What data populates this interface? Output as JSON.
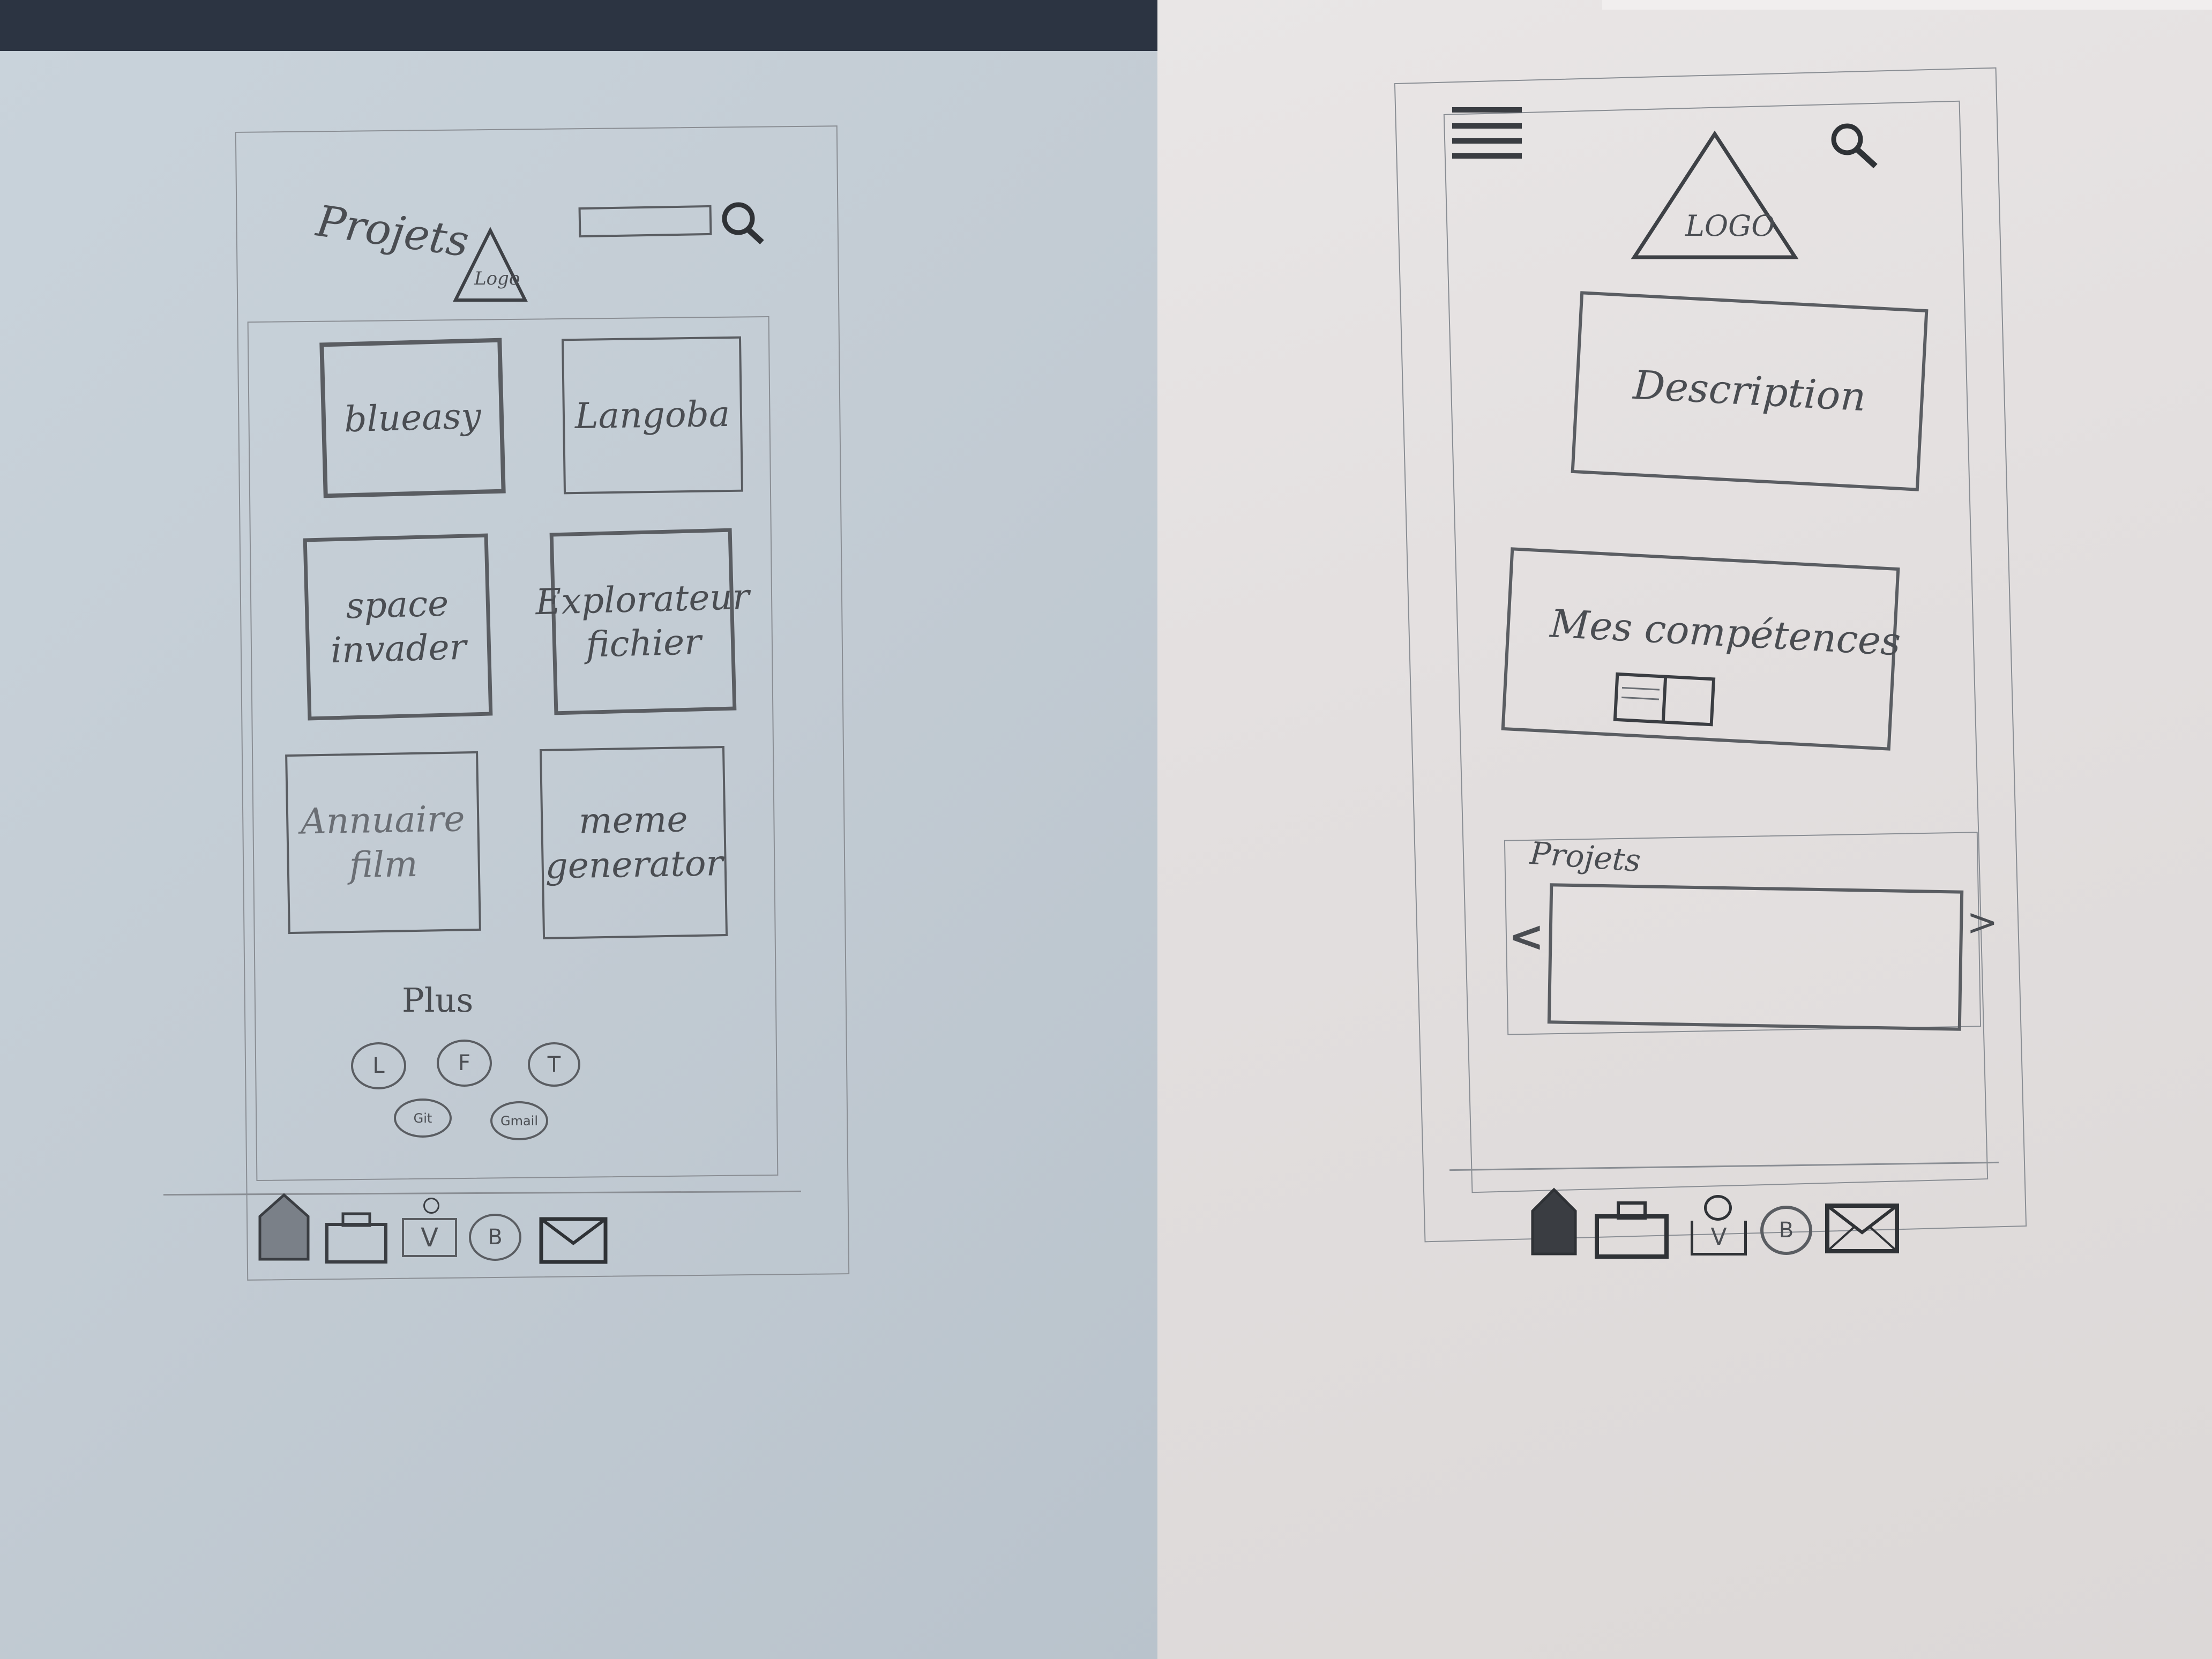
{
  "left_sketch": {
    "title": "Projets",
    "logo_text": "Logo",
    "projects": [
      {
        "label": "blueasy"
      },
      {
        "label": "Langoba"
      },
      {
        "label": "space invader"
      },
      {
        "label": "Explorateur fichier"
      },
      {
        "label": "Annuaire film"
      },
      {
        "label": "meme generator"
      }
    ],
    "more_label": "Plus",
    "social_row1": [
      "L",
      "F",
      "T"
    ],
    "social_row2": [
      "Git",
      "Gmail"
    ],
    "bottom_nav_icons": [
      "home-icon",
      "briefcase-icon",
      "cv-icon",
      "blog-icon",
      "mail-icon"
    ],
    "nav_blog_letter": "B",
    "nav_cv_letter": "V"
  },
  "right_sketch": {
    "logo_text": "LOGO",
    "description_label": "Description",
    "skills_label": "Mes compétences",
    "projects_label": "Projets",
    "carousel_prev": "<",
    "carousel_next": ">",
    "bottom_nav_icons": [
      "home-icon",
      "briefcase-icon",
      "cv-icon",
      "blog-icon",
      "mail-icon"
    ],
    "nav_blog_letter": "B",
    "nav_cv_letter": "V"
  }
}
